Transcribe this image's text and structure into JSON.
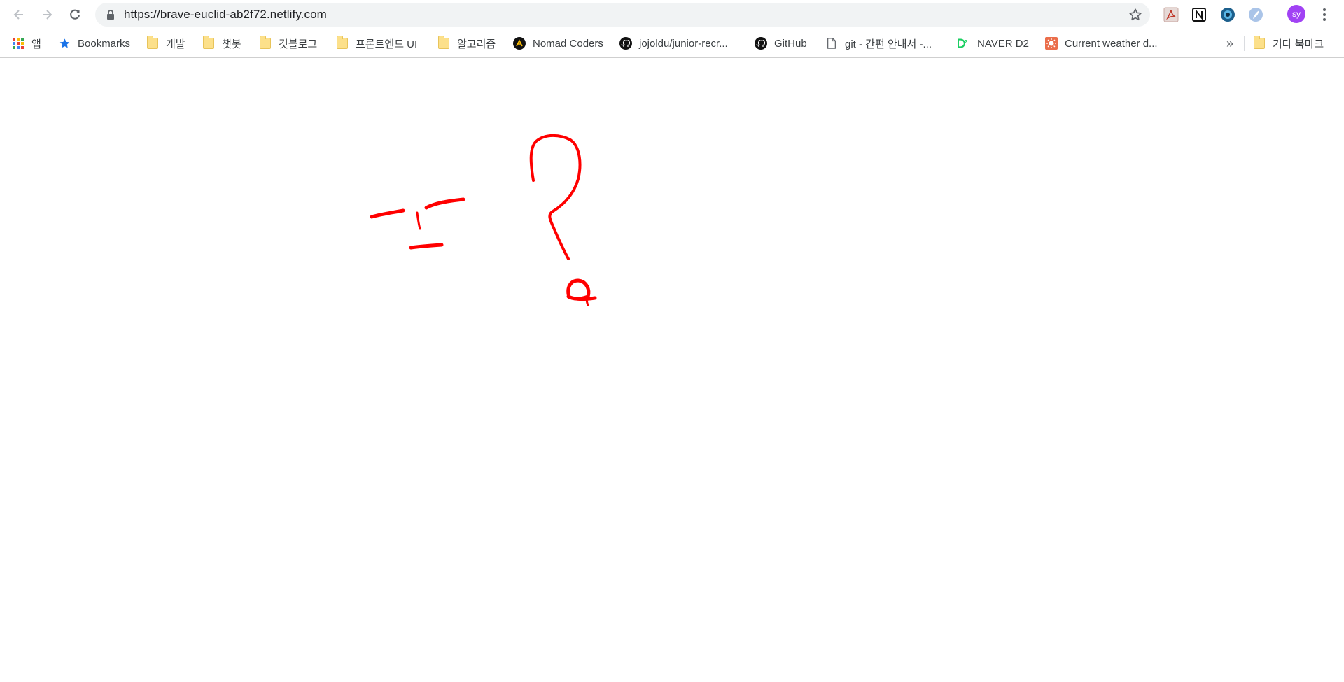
{
  "browser": {
    "url": "https://brave-euclid-ab2f72.netlify.com",
    "profile_initials": "sy",
    "toolbar_icons": [
      "back-arrow-icon",
      "forward-arrow-icon",
      "reload-icon",
      "lock-icon",
      "star-icon",
      "kebab-menu-icon"
    ],
    "extensions": [
      "pdf-extension-icon",
      "notion-extension-icon",
      "blue-circle-extension-icon",
      "feather-extension-icon"
    ]
  },
  "bookmarks": {
    "items": [
      {
        "label": "앱",
        "icon": "apps-grid-icon"
      },
      {
        "label": "Bookmarks",
        "icon": "star-icon"
      },
      {
        "label": "개발",
        "icon": "folder-icon"
      },
      {
        "label": "챗봇",
        "icon": "folder-icon"
      },
      {
        "label": "깃블로그",
        "icon": "folder-icon"
      },
      {
        "label": "프론트엔드 UI",
        "icon": "folder-icon"
      },
      {
        "label": "알고리즘",
        "icon": "folder-icon"
      },
      {
        "label": "Nomad Coders",
        "icon": "nomad-coders-icon"
      },
      {
        "label": "jojoldu/junior-recr...",
        "icon": "github-icon"
      },
      {
        "label": "GitHub",
        "icon": "github-icon"
      },
      {
        "label": "git - 간편 안내서 -...",
        "icon": "page-icon"
      },
      {
        "label": "NAVER D2",
        "icon": "naver-d2-icon"
      },
      {
        "label": "Current weather d...",
        "icon": "weather-icon"
      }
    ],
    "overflow_label": "»",
    "other_bookmarks": {
      "label": "기타 북마크",
      "icon": "folder-icon"
    }
  },
  "canvas": {
    "stroke_color": "#ff0000",
    "background": "#ffffff"
  }
}
